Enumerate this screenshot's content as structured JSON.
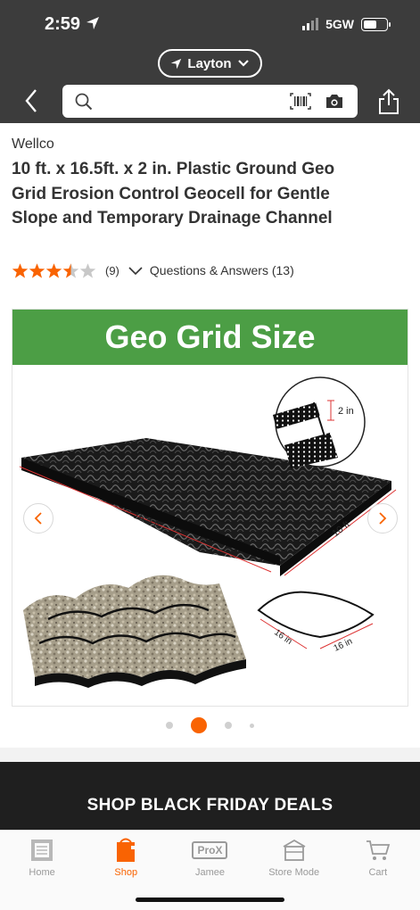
{
  "status_bar": {
    "time": "2:59",
    "network": "5GW"
  },
  "location": {
    "label": "Layton"
  },
  "search": {
    "placeholder": ""
  },
  "product": {
    "brand": "Wellco",
    "title": "10 ft. x 16.5ft. x 2 in. Plastic Ground Geo Grid Erosion Control Geocell for Gentle Slope and Temporary Drainage Channel",
    "rating": 3.5,
    "rating_max": 5,
    "review_count": "(9)",
    "qa_label": "Questions & Answers (13)"
  },
  "image": {
    "banner_text": "Geo Grid Size",
    "dim_length": "16.5 ft",
    "dim_width": "10 ft",
    "dim_height": "2 in",
    "cell_side_a": "16 in",
    "cell_side_b": "16 in"
  },
  "carousel": {
    "active_index": 1,
    "count": 4
  },
  "promo": {
    "text": "SHOP BLACK FRIDAY DEALS"
  },
  "bottom_nav": {
    "items": [
      {
        "label": "Home",
        "icon": "home-depot-logo-icon"
      },
      {
        "label": "Shop",
        "icon": "shop-paint-bucket-icon"
      },
      {
        "label": "Jamee",
        "icon": "prox-icon",
        "icon_text": "ProX"
      },
      {
        "label": "Store Mode",
        "icon": "store-icon"
      },
      {
        "label": "Cart",
        "icon": "cart-icon"
      }
    ],
    "active": "Shop"
  },
  "colors": {
    "accent": "#f96302",
    "header_bg": "#3c3c3c",
    "banner_green": "#4c9e45",
    "star": "#f96302",
    "promo_bg": "#1f1f1f"
  }
}
